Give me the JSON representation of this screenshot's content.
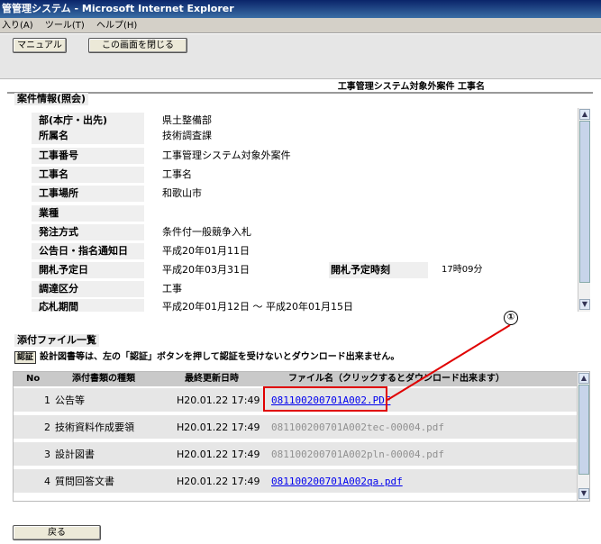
{
  "window": {
    "title": "管管理システム - Microsoft Internet Explorer"
  },
  "menu": [
    "入り(A)",
    "ツール(T)",
    "ヘルプ(H)"
  ],
  "toolbar": {
    "manual_label": "マニュアル",
    "close_label": "この画面を閉じる"
  },
  "headline": "工事管理システム対象外案件 工事名",
  "case_info": {
    "title": "案件情報(照会)",
    "rows": [
      {
        "label": "部(本庁・出先)",
        "value": "県土整備部"
      },
      {
        "label": "所属名",
        "value": "技術調査課"
      },
      {
        "label": "工事番号",
        "value": "工事管理システム対象外案件"
      },
      {
        "label": "工事名",
        "value": "工事名"
      },
      {
        "label": "工事場所",
        "value": "和歌山市"
      },
      {
        "label": "業種",
        "value": ""
      },
      {
        "label": "発注方式",
        "value": "条件付一般競争入札"
      },
      {
        "label": "公告日・指名通知日",
        "value": "平成20年01月11日"
      },
      {
        "label": "開札予定日",
        "value": "平成20年03月31日",
        "label2": "開札予定時刻",
        "value2": "17時09分"
      },
      {
        "label": "調達区分",
        "value": "工事"
      },
      {
        "label": "応札期間",
        "value": "平成20年01月12日 ～ 平成20年01月15日"
      }
    ]
  },
  "attachments": {
    "title": "添付ファイル一覧",
    "auth_button": "認証",
    "notice": "設計図書等は、左の「認証」ボタンを押して認証を受けないとダウンロード出来ません。",
    "headers": {
      "no": "No",
      "type": "添付書類の種類",
      "updated": "最終更新日時",
      "file": "ファイル名（クリックするとダウンロード出来ます）"
    },
    "rows": [
      {
        "no": "1",
        "type": "公告等",
        "updated": "H20.01.22 17:49",
        "file": "081100200701A002.PDF",
        "enabled": true
      },
      {
        "no": "2",
        "type": "技術資料作成要領",
        "updated": "H20.01.22 17:49",
        "file": "081100200701A002tec-00004.pdf",
        "enabled": false
      },
      {
        "no": "3",
        "type": "設計図書",
        "updated": "H20.01.22 17:49",
        "file": "081100200701A002pln-00004.pdf",
        "enabled": false
      },
      {
        "no": "4",
        "type": "質問回答文書",
        "updated": "H20.01.22 17:49",
        "file": "081100200701A002qa.pdf",
        "enabled": true
      }
    ]
  },
  "callout": "①",
  "back_label": "戻る",
  "colors": {
    "highlight_box": "#e00000",
    "link": "#0000ee",
    "disabled_link": "#909090",
    "title_bar": "#0a246a"
  }
}
